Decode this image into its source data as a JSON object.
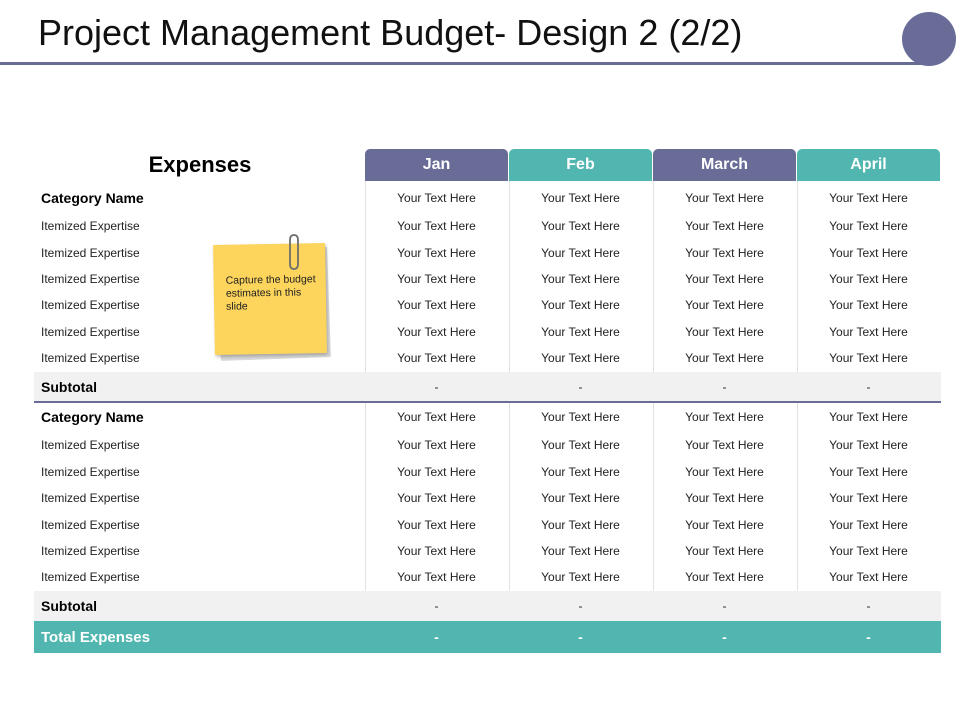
{
  "title": "Project Management Budget- Design 2 (2/2)",
  "colors": {
    "accent": "#686c97",
    "teal": "#52b6b0",
    "note": "#fdd55c"
  },
  "table": {
    "expenses_label": "Expenses",
    "columns": [
      "Jan",
      "Feb",
      "March",
      "April"
    ],
    "sections": [
      {
        "category": "Category Name",
        "category_values": [
          "Your Text Here",
          "Your Text Here",
          "Your Text Here",
          "Your Text Here"
        ],
        "items": [
          {
            "label": "Itemized Expertise",
            "values": [
              "Your Text Here",
              "Your Text Here",
              "Your Text Here",
              "Your Text Here"
            ]
          },
          {
            "label": "Itemized Expertise",
            "values": [
              "Your Text Here",
              "Your Text Here",
              "Your Text Here",
              "Your Text Here"
            ]
          },
          {
            "label": "Itemized Expertise",
            "values": [
              "Your Text Here",
              "Your Text Here",
              "Your Text Here",
              "Your Text Here"
            ]
          },
          {
            "label": "Itemized Expertise",
            "values": [
              "Your Text Here",
              "Your Text Here",
              "Your Text Here",
              "Your Text Here"
            ]
          },
          {
            "label": "Itemized Expertise",
            "values": [
              "Your Text Here",
              "Your Text Here",
              "Your Text Here",
              "Your Text Here"
            ]
          },
          {
            "label": "Itemized Expertise",
            "values": [
              "Your Text Here",
              "Your Text Here",
              "Your Text Here",
              "Your Text Here"
            ]
          }
        ],
        "subtotal_label": "Subtotal",
        "subtotal_values": [
          "-",
          "-",
          "-",
          "-"
        ]
      },
      {
        "category": "Category Name",
        "category_values": [
          "Your Text Here",
          "Your Text Here",
          "Your Text Here",
          "Your Text Here"
        ],
        "items": [
          {
            "label": "Itemized Expertise",
            "values": [
              "Your Text Here",
              "Your Text Here",
              "Your Text Here",
              "Your Text Here"
            ]
          },
          {
            "label": "Itemized Expertise",
            "values": [
              "Your Text Here",
              "Your Text Here",
              "Your Text Here",
              "Your Text Here"
            ]
          },
          {
            "label": "Itemized Expertise",
            "values": [
              "Your Text Here",
              "Your Text Here",
              "Your Text Here",
              "Your Text Here"
            ]
          },
          {
            "label": "Itemized Expertise",
            "values": [
              "Your Text Here",
              "Your Text Here",
              "Your Text Here",
              "Your Text Here"
            ]
          },
          {
            "label": "Itemized Expertise",
            "values": [
              "Your Text Here",
              "Your Text Here",
              "Your Text Here",
              "Your Text Here"
            ]
          },
          {
            "label": "Itemized Expertise",
            "values": [
              "Your Text Here",
              "Your Text Here",
              "Your Text Here",
              "Your Text Here"
            ]
          }
        ],
        "subtotal_label": "Subtotal",
        "subtotal_values": [
          "-",
          "-",
          "-",
          "-"
        ]
      }
    ],
    "total_label": "Total Expenses",
    "total_values": [
      "-",
      "-",
      "-",
      "-"
    ]
  },
  "sticky_note": {
    "text": "Capture the budget estimates in this slide",
    "icon": "paperclip-icon"
  }
}
